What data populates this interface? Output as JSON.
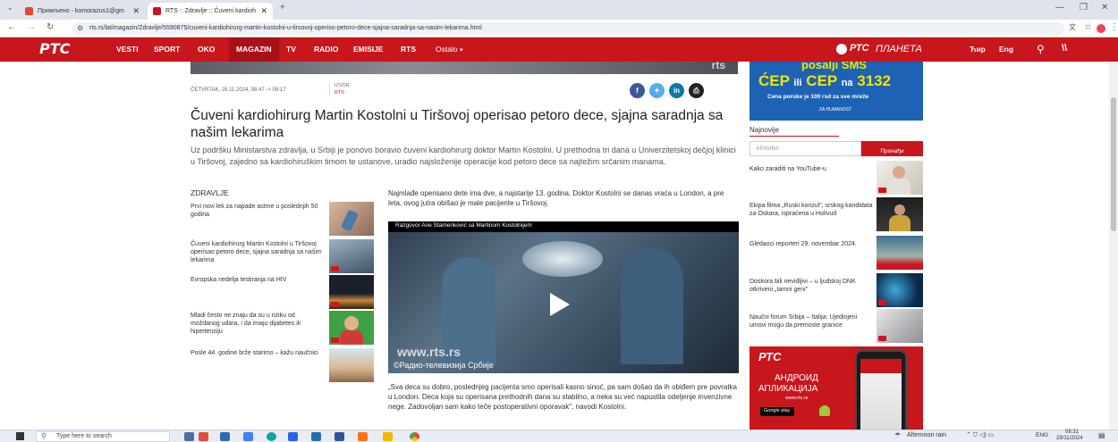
{
  "browser": {
    "tabs": [
      {
        "label": "Примљено - komorazus1@gm",
        "icon": "gmail-icon",
        "active": false
      },
      {
        "label": "RTS :: Zdravlje :: Čuveni kardioh",
        "icon": "rts-icon",
        "active": true
      }
    ],
    "new_tab": "+",
    "url": "rts.rs/lat/magazin/Zdravlje/5590875/cuveni-kardiohirurg-martin-kostolni-u-tirsovoj-operiso-petoro-dece-sjajna-saradnja-sa-nasim-lekarima.html"
  },
  "site": {
    "logo": "РТС",
    "nav": [
      "VESTI",
      "SPORT",
      "OKO",
      "MAGAZIN",
      "TV",
      "RADIO",
      "EMISIJE",
      "RTS",
      "Ostalo"
    ],
    "active_nav": "MAGAZIN",
    "planeta_logo": "РТС",
    "planeta_text": "ПЛАНЕТА",
    "lang_cyr": "Ћир",
    "lang_eng": "Eng",
    "accent": "#c8161d"
  },
  "article": {
    "date": "ČETVRTAK, 28.11.2024, 08:47 -> 09:17",
    "source_label": "IZVOR",
    "source": "RTS",
    "title": "Čuveni kardiohirurg Martin Kostolni u Tiršovoj operisao petoro dece, sjajna saradnja sa našim lekarima",
    "lead": "Uz podršku Ministarstva zdravlja, u Srbiji je ponovo boravio čuveni kardiohirurg doktor Martin Kostolni. U prethodna tri dana u Univerzitetskoj dečjoj klinici u Tiršovoj, zajedno sa kardiohiruškim timom te ustanove, uradio najsloženije operacije kod petoro dece sa najtežim srčanim manama.",
    "para1": "Najmlađe operisano dete ima dve, a najstarije 13. godina. Doktor Kostolni se danas vraća u London, a pre leta, ovog jutra obišao je male pacijente u Tiršovoj.",
    "video_caption": "Razgovor Ane Stamenković sa Martinom Kostolnijem",
    "watermark": "www.rts.rs",
    "copyright": "©Радио-телевизија Србије",
    "quote": "„Sva deca su dobro, poslednjeg pacijenta smo operisali kasno sinoć, pa sam došao da ih obiđem pre povratka u London. Deca koja su operisana prethodnih dana su stabilno, a neka su već napustila odeljenje invenzivne nege. Zadovoljan sam kako teče postoperativni oporavak\", navodi Kostolni."
  },
  "sidebar": {
    "heading": "ZDRAVLJE",
    "items": [
      {
        "title": "Prvi novi lek za napade astme u poslednjih 50 godina",
        "video": false
      },
      {
        "title": "Čuveni kardiohirurg Martin Kostolni u Tiršovoj operisao petoro dece, sjajna saradnja sa našim lekarima",
        "video": true
      },
      {
        "title": "Evropska nedelja testiranja na HIV",
        "video": true
      },
      {
        "title": "Mladi često ne znaju da su u riziku od moždanog udara, i da imaju dijabetes ili hipertenziju",
        "video": true
      },
      {
        "title": "Posle 44. godine brže starimo – kažu naučnici",
        "video": false
      }
    ]
  },
  "right": {
    "ad_line1": "posalji SMS",
    "ad_line2a": "ĆEP",
    "ad_line2b": "ili",
    "ad_line2c": "CEP",
    "ad_line2d": "na",
    "ad_line2e": "3132",
    "ad_line3": "Cena poruke je 100 rsd za sve mreže",
    "ad_brand": "ZA HUMANOST",
    "latest_heading": "Najnovije",
    "archive_placeholder": "АРХИВА",
    "find_button": "Пронађи",
    "items": [
      {
        "title": "Kako zaraditi na YouTube-u",
        "video": true
      },
      {
        "title": "Ekipa filma „Ruski konzul\", srskog kandidata za Oskara, ispraćena u Holivud",
        "video": false
      },
      {
        "title": "Gledaoci reporteri 29. novembar 2024.",
        "video": false
      },
      {
        "title": "Doskora bili nevidljivi – u ljudskoj DNK otkriveni „tamni geni\"",
        "video": true
      },
      {
        "title": "Naučni forum Srbija – Italija: Ujedinjeni umovi mogu da premoste granice",
        "video": true
      }
    ],
    "app_logo": "РТС",
    "app_line1": "АНДРОИД",
    "app_line2": "АПЛИКАЦИЈА",
    "app_url": "www.rts.rs",
    "app_store": "Google play"
  },
  "taskbar": {
    "search_placeholder": "Type here to search",
    "weather": "Afternoon rain",
    "lang": "ENG",
    "time": "08:31",
    "date": "29/11/2024"
  }
}
